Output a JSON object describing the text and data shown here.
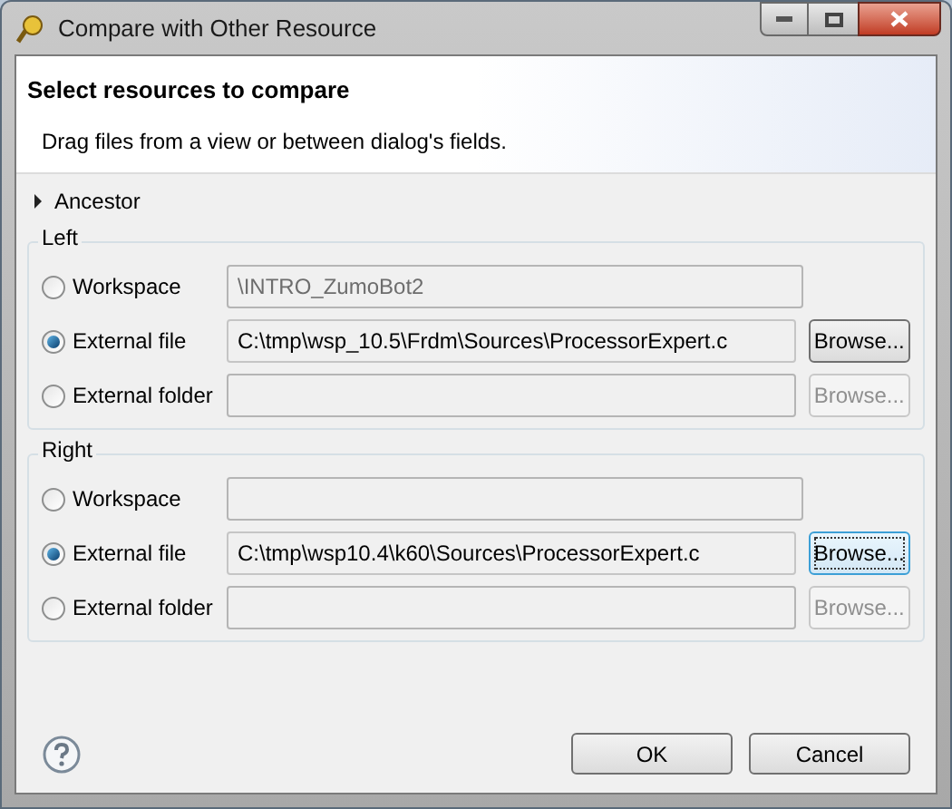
{
  "window": {
    "title": "Compare with Other Resource"
  },
  "header": {
    "title": "Select resources to compare",
    "description": "Drag files from a view or between dialog's fields."
  },
  "ancestor": {
    "label": "Ancestor",
    "expanded": false
  },
  "groups": [
    {
      "title": "Left",
      "rows": [
        {
          "label": "Workspace",
          "selected": false,
          "field": {
            "value": "\\INTRO_ZumoBot2",
            "disabled": true
          }
        },
        {
          "label": "External file",
          "selected": true,
          "field": {
            "value": "C:\\tmp\\wsp_10.5\\Frdm\\Sources\\ProcessorExpert.c",
            "disabled": false
          },
          "browse": {
            "label": "Browse...",
            "disabled": false,
            "focused": false
          }
        },
        {
          "label": "External folder",
          "selected": false,
          "field": {
            "disabled": true
          },
          "browse": {
            "label": "Browse...",
            "disabled": true
          }
        }
      ]
    },
    {
      "title": "Right",
      "rows": [
        {
          "label": "Workspace",
          "selected": false,
          "field": {
            "disabled": true
          }
        },
        {
          "label": "External file",
          "selected": true,
          "field": {
            "value": "C:\\tmp\\wsp10.4\\k60\\Sources\\ProcessorExpert.c",
            "disabled": false
          },
          "browse": {
            "label": "Browse...",
            "disabled": false,
            "focused": true
          }
        },
        {
          "label": "External folder",
          "selected": false,
          "field": {
            "disabled": true
          },
          "browse": {
            "label": "Browse...",
            "disabled": true
          }
        }
      ]
    }
  ],
  "buttons": [
    "OK",
    "Cancel"
  ]
}
